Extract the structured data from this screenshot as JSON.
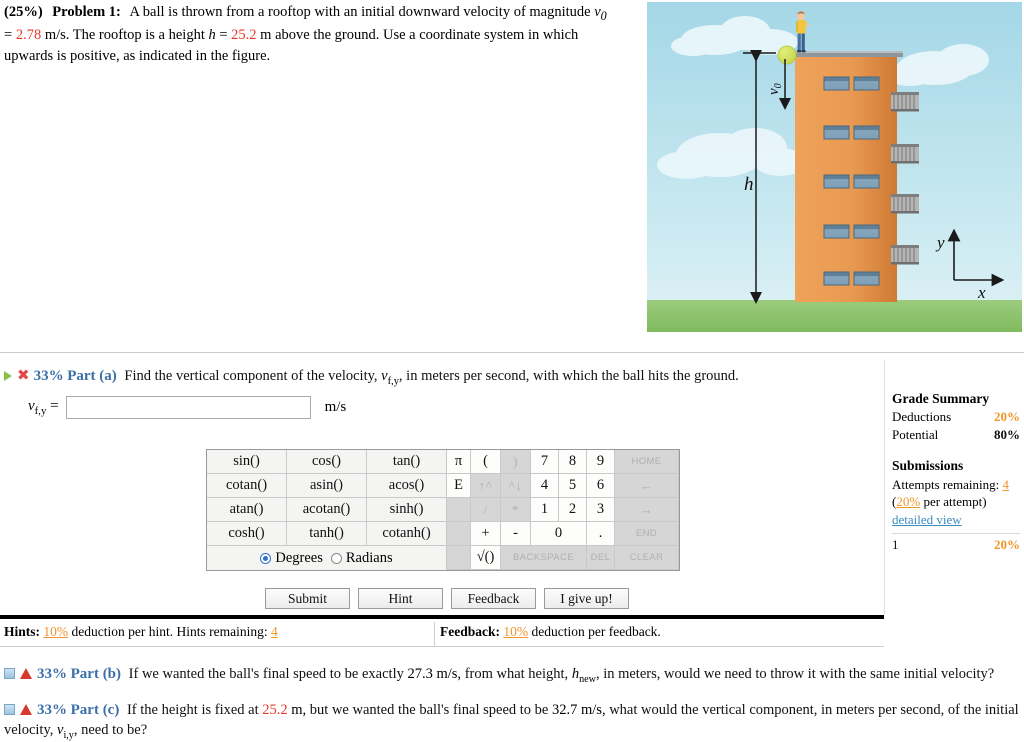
{
  "problem": {
    "percent": "(25%)",
    "label": "Problem 1:",
    "text_1": "A ball is thrown from a rooftop with an initial downward velocity of magnitude",
    "v0_symbol": "v",
    "v0_sub": "0",
    "eq1": "=",
    "v0_value": "2.78",
    "unit_ms": "m/s.",
    "text_2": "The rooftop is a height",
    "h_symbol": "h",
    "eq2": "=",
    "h_value": "25.2",
    "unit_m": "m",
    "text_3": "above the ground. Use a coordinate system in which upwards is positive, as indicated in the figure."
  },
  "figure": {
    "label_v0": "v",
    "label_v0_sub": "0",
    "label_h": "h",
    "label_y": "y",
    "label_x": "x",
    "colors": {
      "sky_top": "#a9d9e8",
      "sky_bottom": "#d6eef4",
      "building_left": "#f0a45e",
      "building_right": "#d07a33",
      "roof": "#9aa0a4",
      "window": "#7d9cb5",
      "window_top": "#5c7f9b",
      "ball": "#cfe05a",
      "grass": "#8dc46a",
      "shirt": "#f2c63d",
      "pants": "#4a6fa5",
      "balcony": "#9a9a9a"
    }
  },
  "part_a": {
    "percent": "33%",
    "name": "Part (a)",
    "question": "Find the vertical component of the velocity,",
    "var_sym": "v",
    "var_sub": "f,y",
    "question_rest": ", in meters per second, with which the ball hits the ground.",
    "answer_label_sym": "v",
    "answer_label_sub": "f,y",
    "answer_eq": "=",
    "answer_value": "",
    "answer_units": "m/s"
  },
  "keypad": {
    "functions": [
      "sin()",
      "cos()",
      "tan()",
      "cotan()",
      "asin()",
      "acos()",
      "atan()",
      "acotan()",
      "sinh()",
      "cosh()",
      "tanh()",
      "cotanh()"
    ],
    "mode_degrees": "Degrees",
    "mode_radians": "Radians",
    "mode_selected": "Degrees",
    "numpad": [
      {
        "label": "π",
        "state": "active"
      },
      {
        "label": "(",
        "state": "active"
      },
      {
        "label": ")",
        "state": "dim-sym"
      },
      {
        "label": "7",
        "state": "active"
      },
      {
        "label": "8",
        "state": "active"
      },
      {
        "label": "9",
        "state": "active"
      },
      {
        "label": "HOME",
        "state": "dim"
      },
      {
        "label": "E",
        "state": "active"
      },
      {
        "label": "↑^",
        "state": "dim-sym"
      },
      {
        "label": "^↓",
        "state": "dim-sym"
      },
      {
        "label": "4",
        "state": "active"
      },
      {
        "label": "5",
        "state": "active"
      },
      {
        "label": "6",
        "state": "active"
      },
      {
        "label": "←",
        "state": "dim-sym"
      },
      {
        "label": "",
        "state": "active"
      },
      {
        "label": "/",
        "state": "dim-sym"
      },
      {
        "label": "*",
        "state": "dim-sym"
      },
      {
        "label": "1",
        "state": "active"
      },
      {
        "label": "2",
        "state": "active"
      },
      {
        "label": "3",
        "state": "active"
      },
      {
        "label": "→",
        "state": "dim-sym"
      },
      {
        "label": "",
        "state": "active"
      },
      {
        "label": "+",
        "state": "active"
      },
      {
        "label": "-",
        "state": "active"
      },
      {
        "label": "0",
        "state": "active-span2"
      },
      {
        "label": ".",
        "state": "active"
      },
      {
        "label": "END",
        "state": "dim"
      },
      {
        "label": "",
        "state": "active"
      },
      {
        "label": "√()",
        "state": "active"
      },
      {
        "label": "BACKSPACE",
        "state": "dim-span3"
      },
      {
        "label": "DEL",
        "state": "dim"
      },
      {
        "label": "CLEAR",
        "state": "dim"
      }
    ]
  },
  "actions": {
    "submit": "Submit",
    "hint": "Hint",
    "feedback": "Feedback",
    "give_up": "I give up!"
  },
  "hints_bar": {
    "hints_title": "Hints:",
    "hints_pct": "10%",
    "hints_text": "deduction per hint. Hints remaining:",
    "hints_remaining": "4",
    "feedback_title": "Feedback:",
    "feedback_pct": "10%",
    "feedback_text": "deduction per feedback."
  },
  "grade_summary": {
    "title": "Grade Summary",
    "deductions_label": "Deductions",
    "deductions_value": "20%",
    "potential_label": "Potential",
    "potential_value": "80%",
    "submissions_title": "Submissions",
    "attempts_label": "Attempts remaining:",
    "attempts_value": "4",
    "per_attempt_open": "(",
    "per_attempt_pct": "20%",
    "per_attempt_close": " per attempt)",
    "detailed_view": "detailed view",
    "attempt_number": "1",
    "attempt_pct": "20%"
  },
  "part_b": {
    "percent": "33%",
    "name": "Part (b)",
    "text_1": "If we wanted the ball's final speed to be exactly",
    "speed_value": "27.3",
    "unit_ms": "m/s,",
    "text_2": "from what height,",
    "var_sym": "h",
    "var_sub": "new",
    "text_3": ", in meters, would we need to throw it with the same initial velocity?"
  },
  "part_c": {
    "percent": "33%",
    "name": "Part (c)",
    "text_1": "If the height is fixed at",
    "height_value": "25.2",
    "unit_m": "m,",
    "text_2": "but we wanted the ball's final speed to be",
    "speed_value": "32.7",
    "unit_ms": "m/s,",
    "text_3": "what would the vertical component, in meters per second, of the initial velocity,",
    "var_sym": "v",
    "var_sub": "i,y",
    "text_4": ", need to be?"
  }
}
